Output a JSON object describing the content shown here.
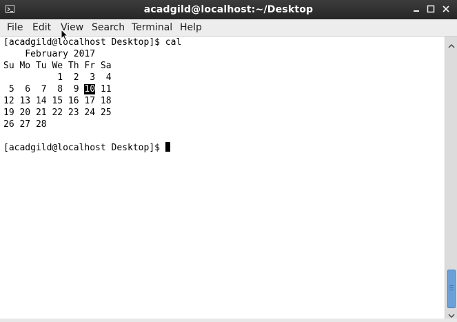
{
  "window": {
    "title": "acadgild@localhost:~/Desktop",
    "icons": {
      "app": "terminal-icon",
      "minimize": "minimize-icon",
      "maximize": "maximize-icon",
      "close": "close-icon"
    }
  },
  "menu": {
    "file": "File",
    "edit": "Edit",
    "view": "View",
    "search": "Search",
    "terminal": "Terminal",
    "help": "Help"
  },
  "terminal": {
    "prompt1": "[acadgild@localhost Desktop]$ cal",
    "cal_header": "    February 2017",
    "cal_days": "Su Mo Tu We Th Fr Sa",
    "cal_week1": "          1  2  3  4",
    "cal_week2_before": " 5  6  7  8  9 ",
    "cal_today": "10",
    "cal_week2_after": " 11",
    "cal_week3": "12 13 14 15 16 17 18",
    "cal_week4": "19 20 21 22 23 24 25",
    "cal_week5": "26 27 28",
    "prompt2": "[acadgild@localhost Desktop]$ "
  },
  "colors": {
    "titlebar": "#2e2e2e",
    "terminal_bg": "#ffffff",
    "scroll_thumb": "#6a9fd8"
  }
}
